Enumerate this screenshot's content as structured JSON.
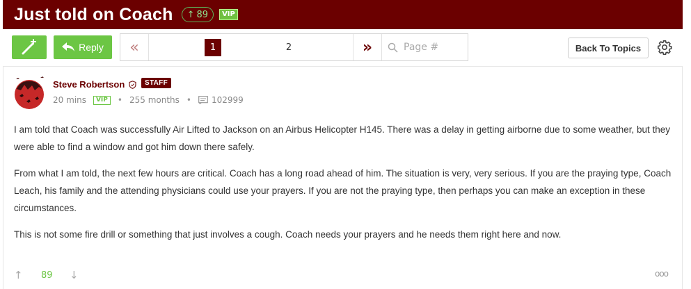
{
  "thread": {
    "title": "Just told on Coach",
    "score": "89",
    "vip_badge": "VIP"
  },
  "toolbar": {
    "reply_label": "Reply",
    "pages": [
      "1",
      "2"
    ],
    "current_page": "1",
    "page_jump_placeholder": "Page #",
    "back_label": "Back To Topics"
  },
  "post": {
    "author": "Steve Robertson",
    "role_badge": "STAFF",
    "time": "20 mins",
    "vip_badge": "VIP",
    "tenure": "255 months",
    "post_count": "102999",
    "paragraphs": [
      "I am told that Coach was successfully Air Lifted to Jackson on an Airbus Helicopter H145. There was a delay in getting airborne due to some weather, but they were able to find a window and got him down there safely.",
      "From what I am told, the next few hours are critical. Coach has a long road ahead of him. The situation is very, very serious. If you are the praying type, Coach Leach, his family and the attending physicians could use your prayers. If you are not the praying type, then perhaps you can make an exception in these circumstances.",
      "This is not some fire drill or something that just involves a cough. Coach needs your prayers and he needs them right here and now."
    ],
    "vote_count": "89"
  },
  "colors": {
    "brand": "#6b0000",
    "accent_green": "#6cc644"
  }
}
